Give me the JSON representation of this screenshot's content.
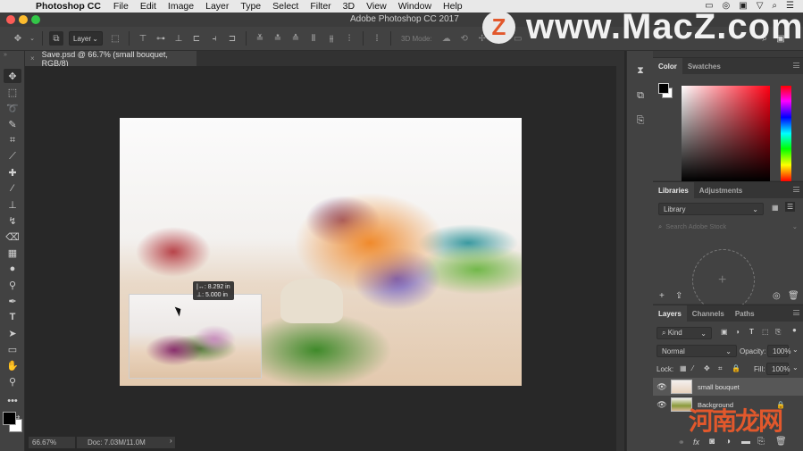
{
  "menubar": {
    "apple_icon": "apple-icon",
    "app_name": "Photoshop CC",
    "items": [
      "File",
      "Edit",
      "Image",
      "Layer",
      "Type",
      "Select",
      "Filter",
      "3D",
      "View",
      "Window",
      "Help"
    ],
    "system_icons": [
      "display-icon",
      "creative-cloud-icon",
      "facetime-icon",
      "wifi-icon",
      "search-icon",
      "list-icon"
    ]
  },
  "window": {
    "title": "Adobe Photoshop CC 2017",
    "traffic_colors": [
      "#fc5c57",
      "#fdbc2e",
      "#33c748"
    ]
  },
  "options_bar": {
    "auto_select_target": "Layer",
    "mode_3d_label": "3D Mode:"
  },
  "watermark": {
    "logo_letter": "Z",
    "url": "www.MacZ.com",
    "logo_color": "#e2582c",
    "cn_text": "河南龙网"
  },
  "document_tab": {
    "close_glyph": "×",
    "title": "Save.psd @ 66.7% (small bouquet, RGB/8)"
  },
  "tools": [
    "move",
    "marquee",
    "lasso",
    "quick-select",
    "crop",
    "eyedropper",
    "healing-brush",
    "brush",
    "clone-stamp",
    "history-brush",
    "eraser",
    "gradient",
    "blur",
    "dodge",
    "pen",
    "type",
    "path-selection",
    "rectangle",
    "hand",
    "zoom",
    "more"
  ],
  "canvas": {
    "measure_width": "|↔: 8.292 in",
    "measure_height": "⊥: 5.000 in"
  },
  "status_bar": {
    "zoom": "66.67%",
    "doc": "Doc: 7.03M/11.0M",
    "arrow": "›"
  },
  "color_panel": {
    "tabs": [
      "Color",
      "Swatches"
    ],
    "foreground": "#000000",
    "background": "#ffffff",
    "hue_color": "#ff0014"
  },
  "libraries_panel": {
    "tabs": [
      "Libraries",
      "Adjustments"
    ],
    "library_select": "Library",
    "search_placeholder": "Search Adobe Stock"
  },
  "layers_panel": {
    "tabs": [
      "Layers",
      "Channels",
      "Paths"
    ],
    "filter_kind": "Kind",
    "blend_mode": "Normal",
    "opacity_label": "Opacity:",
    "opacity_value": "100%",
    "lock_label": "Lock:",
    "fill_label": "Fill:",
    "fill_value": "100%",
    "layers": [
      {
        "name": "small bouquet",
        "selected": true,
        "visible": true,
        "locked": false
      },
      {
        "name": "Background",
        "selected": false,
        "visible": true,
        "locked": true
      }
    ]
  }
}
